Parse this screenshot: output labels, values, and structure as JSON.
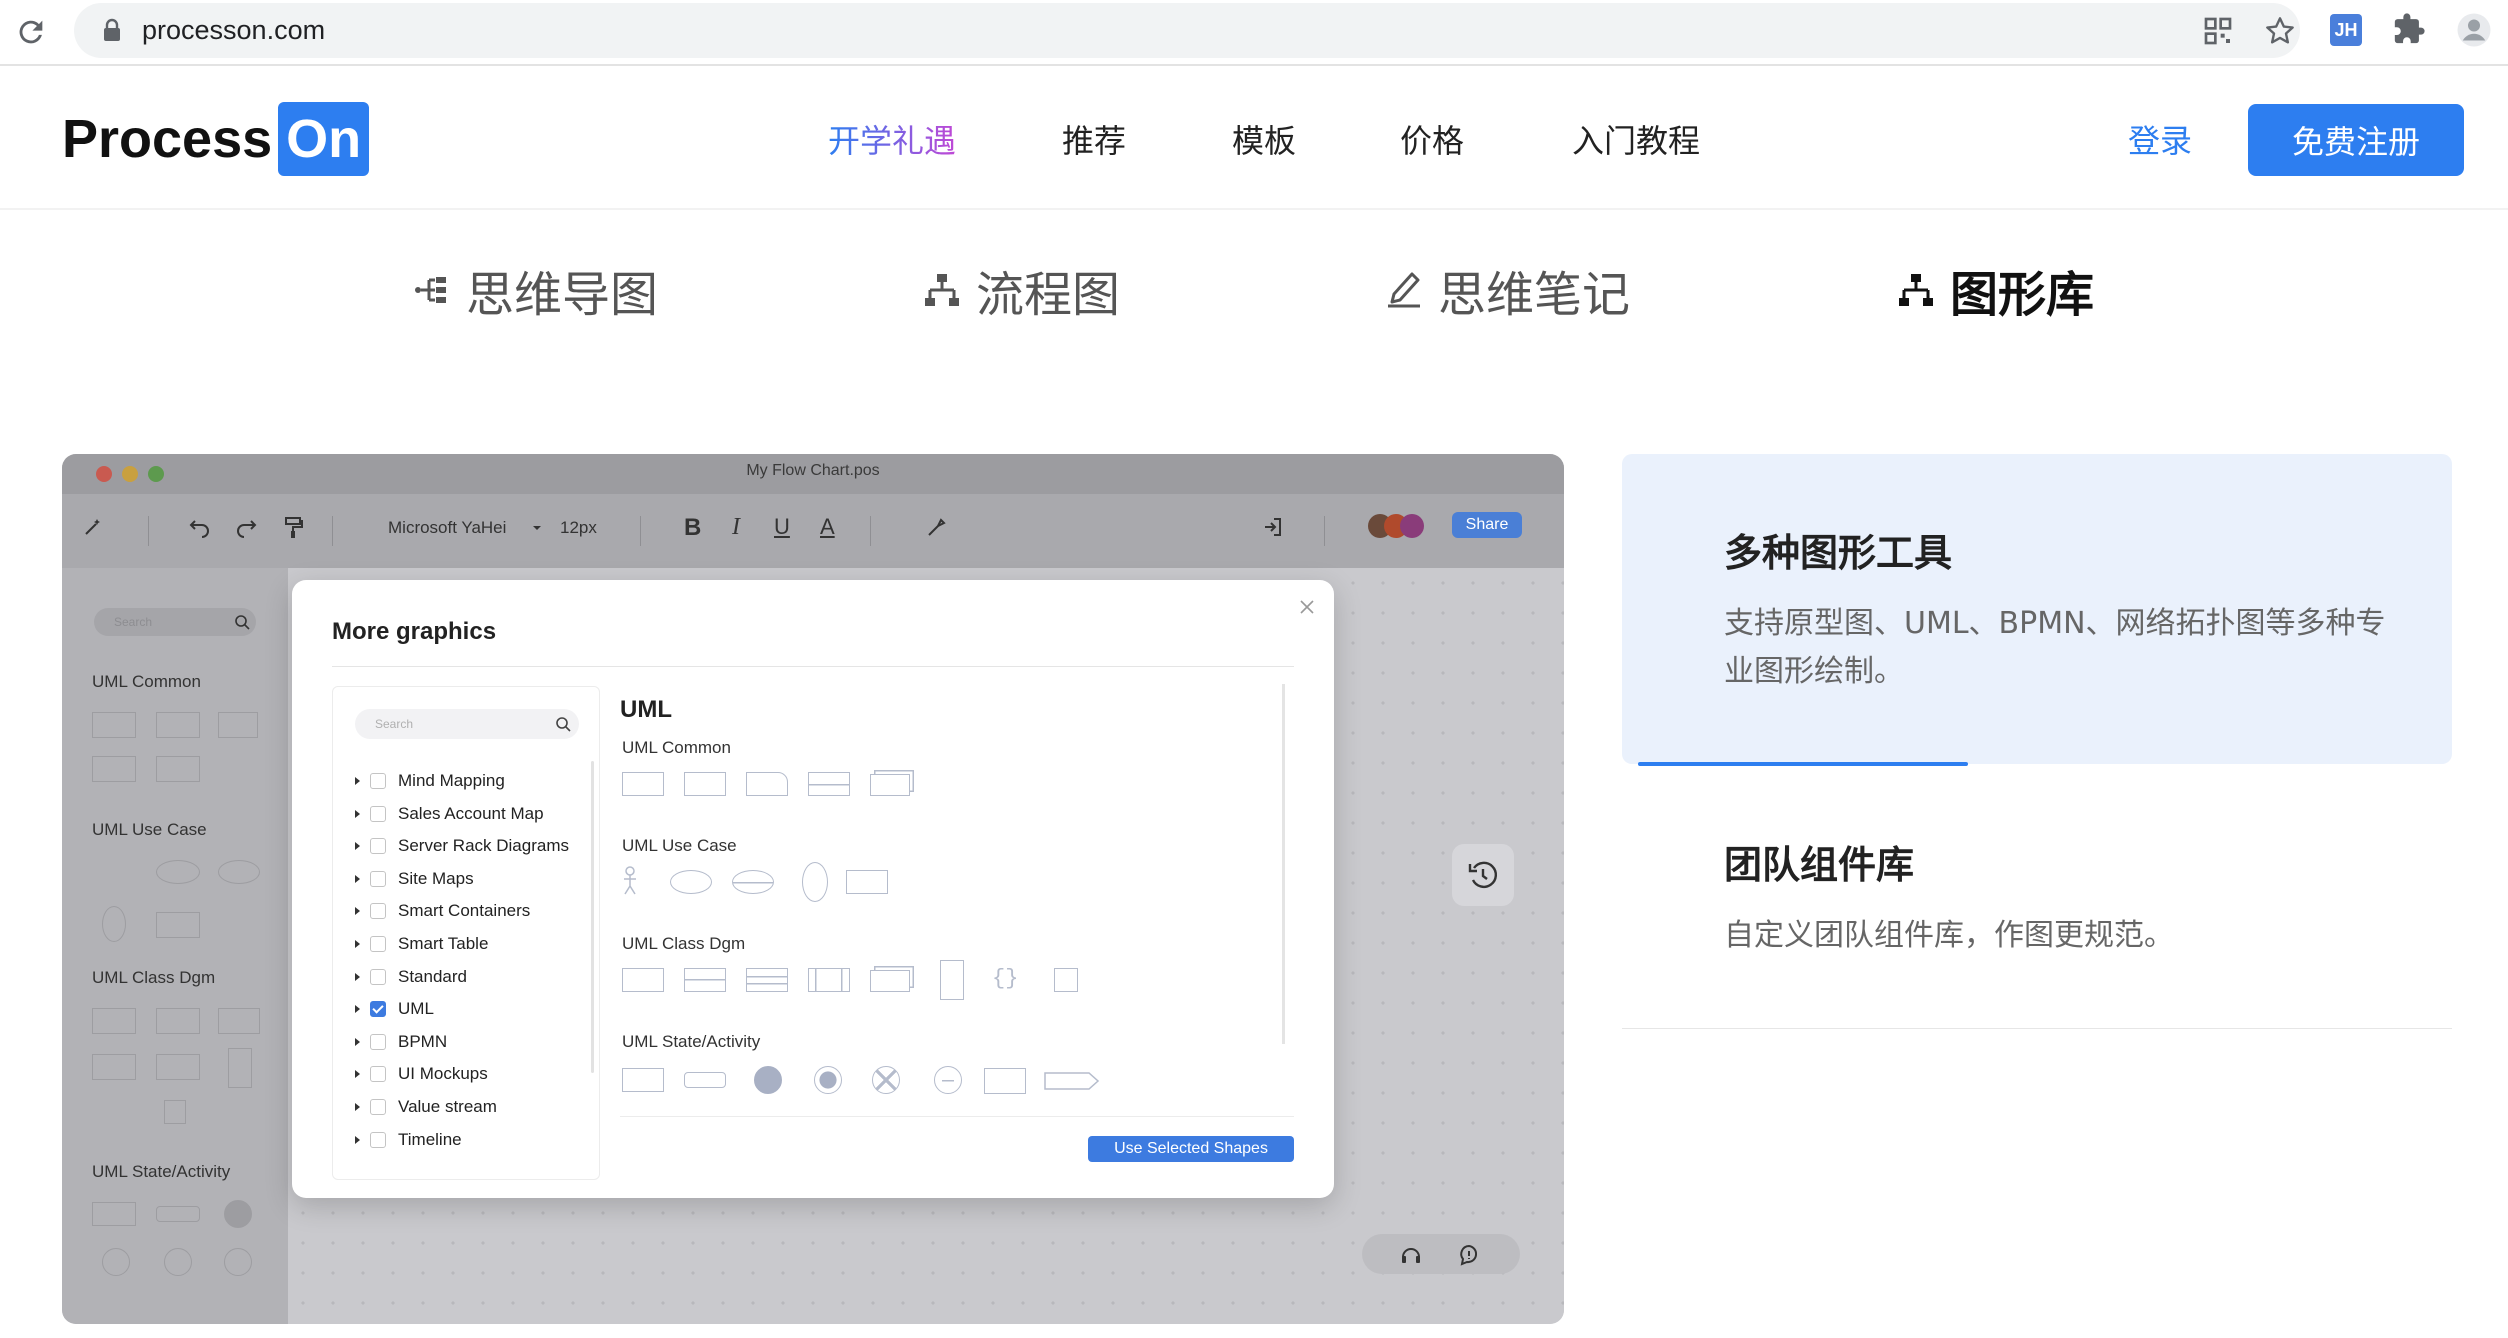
{
  "browser": {
    "url": "processon.com",
    "extension_badge": "JH"
  },
  "header": {
    "logo_text": "Process",
    "logo_badge": "On",
    "nav": [
      "开学礼遇",
      "推荐",
      "模板",
      "价格",
      "入门教程"
    ],
    "login": "登录",
    "signup": "免费注册"
  },
  "product_tabs": [
    {
      "label": "思维导图",
      "icon": "mindmap-icon"
    },
    {
      "label": "流程图",
      "icon": "flowchart-icon"
    },
    {
      "label": "思维笔记",
      "icon": "pen-icon"
    },
    {
      "label": "图形库",
      "icon": "shape-library-icon",
      "active": true
    }
  ],
  "editor": {
    "title": "My Flow Chart.pos",
    "font": "Microsoft  YaHei",
    "font_size": "12px",
    "share": "Share",
    "search_placeholder": "Search",
    "sidebar_sections": [
      "UML Common",
      "UML Use Case",
      "UML Class Dgm",
      "UML State/Activity"
    ]
  },
  "modal": {
    "title": "More graphics",
    "search_placeholder": "Search",
    "libraries": [
      {
        "label": "Mind Mapping",
        "checked": false
      },
      {
        "label": "Sales Account Map",
        "checked": false
      },
      {
        "label": "Server Rack Diagrams",
        "checked": false
      },
      {
        "label": "Site Maps",
        "checked": false
      },
      {
        "label": "Smart Containers",
        "checked": false
      },
      {
        "label": "Smart Table",
        "checked": false
      },
      {
        "label": "Standard",
        "checked": false
      },
      {
        "label": "UML",
        "checked": true
      },
      {
        "label": "BPMN",
        "checked": false
      },
      {
        "label": "UI Mockups",
        "checked": false
      },
      {
        "label": "Value stream",
        "checked": false
      },
      {
        "label": "Timeline",
        "checked": false
      }
    ],
    "preview_title": "UML",
    "preview_sections": [
      "UML Common",
      "UML Use Case",
      "UML Class Dgm",
      "UML State/Activity"
    ],
    "use_button": "Use Selected Shapes"
  },
  "features": [
    {
      "title": "多种图形工具",
      "desc": "支持原型图、UML、BPMN、网络拓扑图等多种专业图形绘制。"
    },
    {
      "title": "团队组件库",
      "desc": "自定义团队组件库，作图更规范。"
    }
  ],
  "colors": {
    "brand": "#2d7ef0",
    "card_bg": "#eaf1fc"
  }
}
